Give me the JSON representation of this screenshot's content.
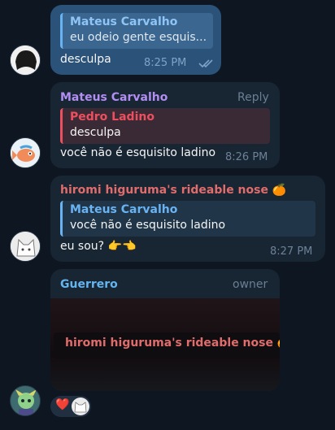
{
  "messages": [
    {
      "quote_name": "Mateus Carvalho",
      "quote_text": "eu odeio gente esquis...",
      "text": "desculpa",
      "time": "8:25 PM",
      "read_icon": "double-check-icon"
    },
    {
      "sender": "Mateus Carvalho",
      "reply_label": "Reply",
      "quote_name": "Pedro Ladino",
      "quote_text": "desculpa",
      "text": "você não é esquisito ladino",
      "time": "8:26 PM"
    },
    {
      "sender": "hiromi higuruma's rideable nose 🍊",
      "quote_name": "Mateus Carvalho",
      "quote_text": "você não é esquisito ladino",
      "text": "eu sou? 👉👈",
      "time": "8:27 PM"
    },
    {
      "sender": "Guerrero",
      "role": "owner",
      "media_caption": "hiromi higuruma's rideable nose 🍊"
    }
  ],
  "reaction": {
    "emoji": "❤️"
  },
  "colors": {
    "background": "#0e1621",
    "incoming_bubble": "#182533",
    "outgoing_bubble": "#2b5278",
    "mateus": "#6ab3f3",
    "pedro": "#ee4f5f",
    "guerrero": "#64b5ef",
    "hiromi": "#e06c6c"
  }
}
